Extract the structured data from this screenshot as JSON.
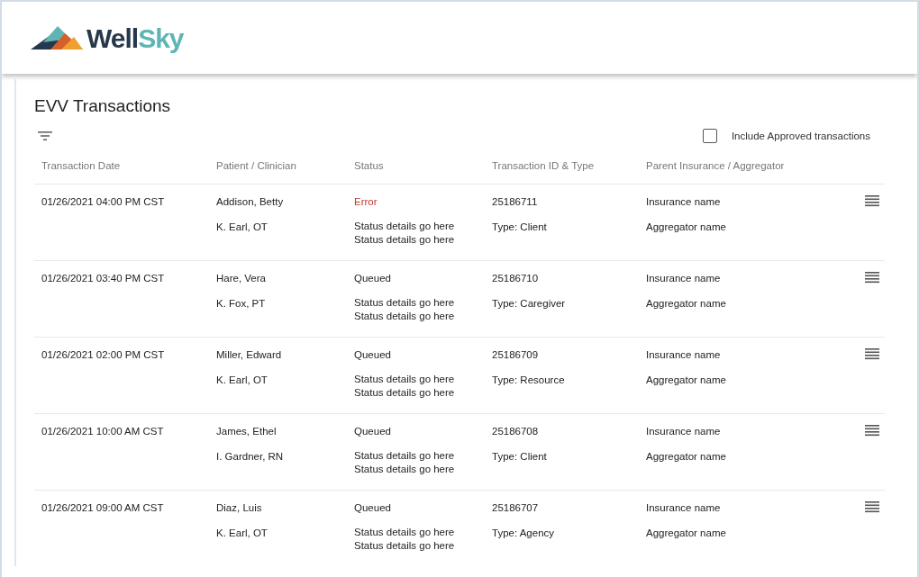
{
  "brand": {
    "name": "WellSky"
  },
  "page": {
    "title": "EVV Transactions"
  },
  "filter": {
    "label": "Include Approved transactions",
    "checked": false
  },
  "table": {
    "columns": [
      "Transaction Date",
      "Patient / Clinician",
      "Status",
      "Transaction ID & Type",
      "Parent Insurance / Aggregator"
    ],
    "rows": [
      {
        "date": "01/26/2021 04:00 PM CST",
        "patient": "Addison, Betty",
        "clinician": "K. Earl, OT",
        "status": "Error",
        "error": true,
        "details": [
          "Status details go here",
          "Status details go here"
        ],
        "id": "25186711",
        "type": "Type: Client",
        "insurance": "Insurance name",
        "aggregator": "Aggregator name"
      },
      {
        "date": "01/26/2021 03:40 PM CST",
        "patient": "Hare, Vera",
        "clinician": "K. Fox, PT",
        "status": "Queued",
        "error": false,
        "details": [
          "Status details go here",
          "Status details go here"
        ],
        "id": "25186710",
        "type": "Type: Caregiver",
        "insurance": "Insurance name",
        "aggregator": "Aggregator name"
      },
      {
        "date": "01/26/2021 02:00 PM CST",
        "patient": "Miller, Edward",
        "clinician": "K. Earl, OT",
        "status": "Queued",
        "error": false,
        "details": [
          "Status details go here",
          "Status details go here"
        ],
        "id": "25186709",
        "type": "Type: Resource",
        "insurance": "Insurance name",
        "aggregator": "Aggregator name"
      },
      {
        "date": "01/26/2021 10:00 AM CST",
        "patient": "James, Ethel",
        "clinician": "I. Gardner, RN",
        "status": "Queued",
        "error": false,
        "details": [
          "Status details go here",
          "Status details go here"
        ],
        "id": "25186708",
        "type": "Type: Client",
        "insurance": "Insurance name",
        "aggregator": "Aggregator name"
      },
      {
        "date": "01/26/2021 09:00 AM CST",
        "patient": "Diaz, Luis",
        "clinician": "K. Earl, OT",
        "status": "Queued",
        "error": false,
        "details": [
          "Status details go here",
          "Status details go here"
        ],
        "id": "25186707",
        "type": "Type: Agency",
        "insurance": "Insurance name",
        "aggregator": "Aggregator name"
      }
    ]
  }
}
